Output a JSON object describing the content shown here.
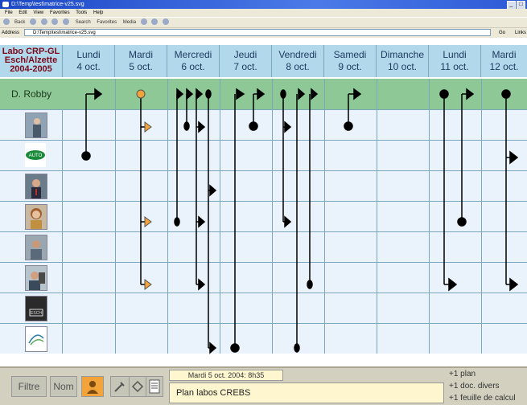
{
  "window": {
    "title": "D:\\Temp\\test\\matrice-v25.svg",
    "menu": [
      "File",
      "Edit",
      "View",
      "Favorites",
      "Tools",
      "Help"
    ],
    "toolbar": [
      "Back",
      "Search",
      "Favorites",
      "Media"
    ],
    "address_label": "Address",
    "address": "D:\\Temp\\test\\matrice-v25.svg",
    "go_label": "Go",
    "links_label": "Links"
  },
  "grid": {
    "corner": [
      "Labo CRP-GL",
      "Esch/Alzette",
      "2004-2005"
    ],
    "days": [
      {
        "day": "Lundi",
        "date": "4 oct."
      },
      {
        "day": "Mardi",
        "date": "5 oct."
      },
      {
        "day": "Mercredi",
        "date": "6 oct."
      },
      {
        "day": "Jeudi",
        "date": "7 oct."
      },
      {
        "day": "Vendredi",
        "date": "8 oct."
      },
      {
        "day": "Samedi",
        "date": "9 oct."
      },
      {
        "day": "Dimanche",
        "date": "10 oct."
      },
      {
        "day": "Lundi",
        "date": "11 oct."
      },
      {
        "day": "Mardi",
        "date": "12 oct."
      }
    ],
    "person": "D. Robby",
    "rows": [
      "photo-1",
      "logo-auto",
      "photo-2",
      "photo-3",
      "photo-4",
      "photo-5",
      "logo-esch",
      "logo-ministere"
    ],
    "colors": {
      "header": "#b2d8eb",
      "person_row": "#8ec896",
      "cell": "#eaf3fb",
      "selected": "#f2a33a"
    }
  },
  "bottom": {
    "filter_label": "Filtre",
    "name_label": "Nom",
    "date_text": "Mardi 5 oct. 2004: 8h35",
    "note_text": "Plan labos CREBS",
    "extras": [
      "+1 plan",
      "+1 doc. divers",
      "+1 feuille de calcul"
    ]
  }
}
